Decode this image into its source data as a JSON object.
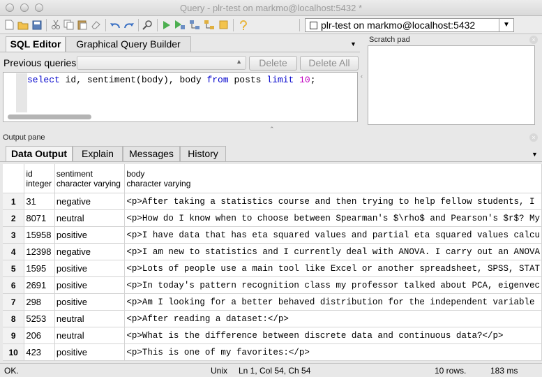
{
  "window": {
    "title": "Query - plr-test on markmo@localhost:5432 *"
  },
  "toolbar": {
    "connection": "plr-test on markmo@localhost:5432",
    "icons": [
      "new-file-icon",
      "open-file-icon",
      "save-icon",
      "cut-icon",
      "copy-icon",
      "paste-icon",
      "clear-icon",
      "undo-icon",
      "redo-icon",
      "find-icon",
      "execute-icon",
      "execute-pgscript-icon",
      "explain-icon",
      "explain-analyze-icon",
      "cancel-icon",
      "help-icon"
    ]
  },
  "editor": {
    "tabs": [
      "SQL Editor",
      "Graphical Query Builder"
    ],
    "previous_queries_label": "Previous queries",
    "delete_label": "Delete",
    "delete_all_label": "Delete All",
    "sql_parts": [
      "select",
      " id, sentiment(body), body ",
      "from",
      " posts ",
      "limit",
      " ",
      "10",
      ";"
    ]
  },
  "scratch_pad": {
    "title": "Scratch pad"
  },
  "output": {
    "title": "Output pane",
    "tabs": [
      "Data Output",
      "Explain",
      "Messages",
      "History"
    ],
    "columns": [
      {
        "name": "id",
        "type": "integer"
      },
      {
        "name": "sentiment",
        "type": "character varying"
      },
      {
        "name": "body",
        "type": "character varying"
      }
    ],
    "rows": [
      {
        "n": "1",
        "id": "31",
        "sentiment": "negative",
        "body": "<p>After taking a statistics course and then trying to help fellow students, I"
      },
      {
        "n": "2",
        "id": "8071",
        "sentiment": "neutral",
        "body": "<p>How do I know when to choose between Spearman's $\\rho$ and Pearson's $r$? My"
      },
      {
        "n": "3",
        "id": "15958",
        "sentiment": "positive",
        "body": "<p>I have data that has eta squared values and partial eta squared values calcu"
      },
      {
        "n": "4",
        "id": "12398",
        "sentiment": "negative",
        "body": "<p>I am new to statistics and I currently deal with ANOVA. I carry out an ANOVA"
      },
      {
        "n": "5",
        "id": "1595",
        "sentiment": "positive",
        "body": "<p>Lots of people use a main tool like Excel or another spreadsheet, SPSS, STAT"
      },
      {
        "n": "6",
        "id": "2691",
        "sentiment": "positive",
        "body": "<p>In today's pattern recognition class my professor talked about PCA, eigenvec"
      },
      {
        "n": "7",
        "id": "298",
        "sentiment": "positive",
        "body": "<p>Am I looking for a better behaved distribution for the independent variable"
      },
      {
        "n": "8",
        "id": "5253",
        "sentiment": "neutral",
        "body": "<p>After reading a dataset:</p>"
      },
      {
        "n": "9",
        "id": "206",
        "sentiment": "neutral",
        "body": "<p>What is the difference between discrete data and continuous data?</p>"
      },
      {
        "n": "10",
        "id": "423",
        "sentiment": "positive",
        "body": "<p>This is one of my favorites:</p>"
      }
    ]
  },
  "status": {
    "state": "OK.",
    "line_ending": "Unix",
    "position": "Ln 1, Col 54, Ch 54",
    "rows": "10 rows.",
    "time": "183 ms"
  }
}
